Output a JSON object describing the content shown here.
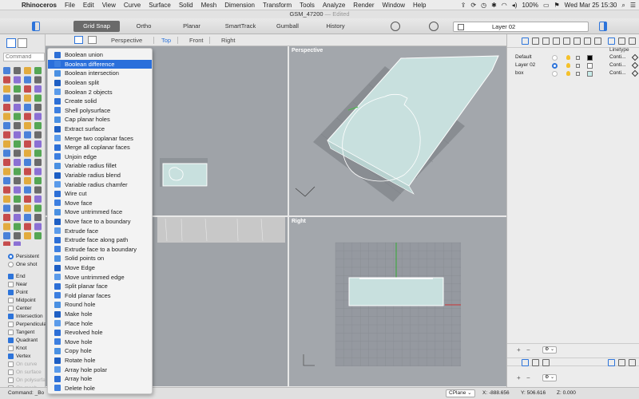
{
  "menubar": {
    "app_name": "Rhinoceros",
    "items": [
      "File",
      "Edit",
      "View",
      "Curve",
      "Surface",
      "Solid",
      "Mesh",
      "Dimension",
      "Transform",
      "Tools",
      "Analyze",
      "Render",
      "Window",
      "Help"
    ],
    "battery": "100%",
    "datetime": "Wed Mar 25  15:30"
  },
  "window": {
    "title": "GSM_47200",
    "status": "Edited"
  },
  "toolbar": {
    "buttons": [
      "Grid Snap",
      "Ortho",
      "Planar",
      "SmartTrack",
      "Gumball",
      "History"
    ],
    "active": "Grid Snap",
    "layer": "Layer 02"
  },
  "viewport_tabs": [
    "Perspective",
    "Top",
    "Front",
    "Right"
  ],
  "active_viewport_tab": "Top",
  "viewports": {
    "perspective": "Perspective",
    "right": "Right"
  },
  "left_panel": {
    "command_placeholder": "Command",
    "osnap": [
      {
        "label": "Persistent",
        "kind": "radio",
        "checked": true,
        "disabled": false
      },
      {
        "label": "One shot",
        "kind": "radio",
        "checked": false,
        "disabled": false
      },
      {
        "label": "End",
        "kind": "check",
        "checked": true,
        "disabled": false
      },
      {
        "label": "Near",
        "kind": "check",
        "checked": false,
        "disabled": false
      },
      {
        "label": "Point",
        "kind": "check",
        "checked": true,
        "disabled": false
      },
      {
        "label": "Midpoint",
        "kind": "check",
        "checked": false,
        "disabled": false
      },
      {
        "label": "Center",
        "kind": "check",
        "checked": false,
        "disabled": false
      },
      {
        "label": "Intersection",
        "kind": "check",
        "checked": true,
        "disabled": false
      },
      {
        "label": "Perpendicular",
        "kind": "check",
        "checked": false,
        "disabled": false
      },
      {
        "label": "Tangent",
        "kind": "check",
        "checked": false,
        "disabled": false
      },
      {
        "label": "Quadrant",
        "kind": "check",
        "checked": true,
        "disabled": false
      },
      {
        "label": "Knot",
        "kind": "check",
        "checked": false,
        "disabled": false
      },
      {
        "label": "Vertex",
        "kind": "check",
        "checked": true,
        "disabled": false
      },
      {
        "label": "On curve",
        "kind": "check",
        "checked": false,
        "disabled": true
      },
      {
        "label": "On surface",
        "kind": "check",
        "checked": false,
        "disabled": true
      },
      {
        "label": "On polysurface",
        "kind": "check",
        "checked": false,
        "disabled": true
      },
      {
        "label": "On mesh",
        "kind": "check",
        "checked": false,
        "disabled": true
      }
    ]
  },
  "dropdown_menu": {
    "selected": "Boolean difference",
    "items": [
      {
        "label": "Boolean union",
        "icon": "boolean-union-icon"
      },
      {
        "label": "Boolean difference",
        "icon": "boolean-difference-icon"
      },
      {
        "label": "Boolean intersection",
        "icon": "boolean-intersection-icon"
      },
      {
        "label": "Boolean split",
        "icon": "boolean-split-icon"
      },
      {
        "label": "Boolean 2 objects",
        "icon": "boolean-2-objects-icon"
      },
      {
        "label": "Create solid",
        "icon": "create-solid-icon"
      },
      {
        "label": "Shell polysurface",
        "icon": "shell-polysurface-icon"
      },
      {
        "label": "Cap planar holes",
        "icon": "cap-planar-holes-icon"
      },
      {
        "label": "Extract surface",
        "icon": "extract-surface-icon"
      },
      {
        "label": "Merge two coplanar faces",
        "icon": "merge-two-coplanar-faces-icon"
      },
      {
        "label": "Merge all coplanar faces",
        "icon": "merge-all-coplanar-faces-icon"
      },
      {
        "label": "Unjoin edge",
        "icon": "unjoin-edge-icon"
      },
      {
        "label": "Variable radius fillet",
        "icon": "variable-radius-fillet-icon"
      },
      {
        "label": "Variable radius blend",
        "icon": "variable-radius-blend-icon"
      },
      {
        "label": "Variable radius chamfer",
        "icon": "variable-radius-chamfer-icon"
      },
      {
        "label": "Wire cut",
        "icon": "wire-cut-icon"
      },
      {
        "label": "Move face",
        "icon": "move-face-icon"
      },
      {
        "label": "Move untrimmed face",
        "icon": "move-untrimmed-face-icon"
      },
      {
        "label": "Move face to a boundary",
        "icon": "move-face-to-boundary-icon"
      },
      {
        "label": "Extrude face",
        "icon": "extrude-face-icon"
      },
      {
        "label": "Extrude face along path",
        "icon": "extrude-face-along-path-icon"
      },
      {
        "label": "Extrude face to a boundary",
        "icon": "extrude-face-to-boundary-icon"
      },
      {
        "label": "Solid points on",
        "icon": "solid-points-on-icon"
      },
      {
        "label": "Move Edge",
        "icon": "move-edge-icon"
      },
      {
        "label": "Move untrimmed edge",
        "icon": "move-untrimmed-edge-icon"
      },
      {
        "label": "Split planar face",
        "icon": "split-planar-face-icon"
      },
      {
        "label": "Fold planar faces",
        "icon": "fold-planar-faces-icon"
      },
      {
        "label": "Round hole",
        "icon": "round-hole-icon"
      },
      {
        "label": "Make hole",
        "icon": "make-hole-icon"
      },
      {
        "label": "Place hole",
        "icon": "place-hole-icon"
      },
      {
        "label": "Revolved hole",
        "icon": "revolved-hole-icon"
      },
      {
        "label": "Move hole",
        "icon": "move-hole-icon"
      },
      {
        "label": "Copy hole",
        "icon": "copy-hole-icon"
      },
      {
        "label": "Rotate hole",
        "icon": "rotate-hole-icon"
      },
      {
        "label": "Array hole polar",
        "icon": "array-hole-polar-icon"
      },
      {
        "label": "Array hole",
        "icon": "array-hole-icon"
      },
      {
        "label": "Delete hole",
        "icon": "delete-hole-icon"
      }
    ]
  },
  "layers_panel": {
    "linetype_header": "Linetype",
    "layers": [
      {
        "name": "Default",
        "current": false,
        "color": "#000000",
        "linetype": "Conti..."
      },
      {
        "name": "Layer 02",
        "current": true,
        "color": "#ffffff",
        "linetype": "Conti..."
      },
      {
        "name": "box",
        "current": false,
        "color": "#c8ecea",
        "linetype": "Conti..."
      }
    ]
  },
  "statusbar": {
    "command": "Command: _Bo",
    "cplane": "CPlane",
    "x": "X: -888.656",
    "y": "Y: 506.616",
    "z": "Z: 0.000"
  },
  "colors": {
    "accent": "#2a6fdb",
    "viewport_bg": "#a3a7ac",
    "object_fill": "#c8e0de"
  }
}
